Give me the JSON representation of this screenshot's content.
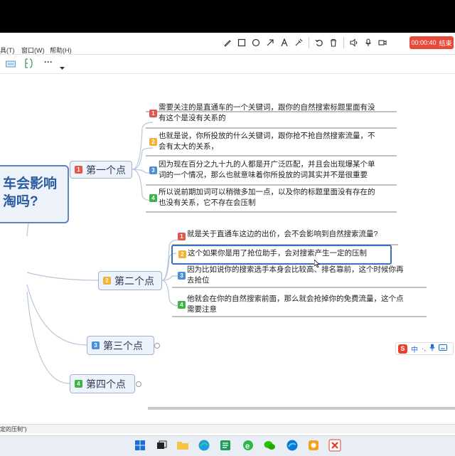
{
  "recorder": {
    "timer": "00:00:40",
    "end_label": "结束",
    "tools": [
      "pen-icon",
      "rectangle-icon",
      "circle-icon",
      "arrow-icon",
      "text-icon",
      "highlighter-icon",
      "undo-icon",
      "trash-icon",
      "speaker-icon",
      "microphone-icon",
      "camera-icon"
    ]
  },
  "menubar": {
    "items": [
      "具(T)",
      "窗口(W)",
      "帮助(H)"
    ]
  },
  "toolbar": {
    "more_label": "···"
  },
  "mindmap": {
    "central": [
      "车会影响",
      "淘吗?"
    ],
    "topics": [
      {
        "badge": "1",
        "label": "第一个点",
        "leaves": [
          {
            "badge": "1",
            "lines": [
              "需要关注的是直通车的一个关键词，跟你的自然搜索标题里面有没",
              "有这个是没有关系的"
            ]
          },
          {
            "badge": "2",
            "lines": [
              "也就是说，你所投放的什么关键词，跟你抢不抢自然搜索流量，不",
              "会有太大的关系，"
            ]
          },
          {
            "badge": "3",
            "lines": [
              "因为现在百分之九十九的人都是开广泛匹配，并且会出现爆某个单",
              "词的一个情况，那么也就意味着你所投放的词其实并不是很重要"
            ]
          },
          {
            "badge": "4",
            "lines": [
              "所以说前期加词可以稍微多加一点，以及你的标题里面没有存在的",
              "也没有关系，它不存在会压制"
            ]
          }
        ]
      },
      {
        "badge": "2",
        "label": "第二个点",
        "leaves": [
          {
            "badge": "1",
            "lines": [
              "就是关于直通车这边的出价，会不会影响到自然搜索流量?"
            ]
          },
          {
            "badge": "2",
            "lines": [
              "这个如果你是用了抢位助手，会对搜索产生一定的压制"
            ]
          },
          {
            "badge": "3",
            "lines": [
              "因为比如说你的搜索选手本身会比较高、排名靠前，这个时候你再",
              "去抢位"
            ]
          },
          {
            "badge": "4",
            "lines": [
              "他就会在你的自然搜索前面，那么就会抢掉你的免费流量，这个点",
              "需要注意"
            ]
          }
        ]
      },
      {
        "badge": "3",
        "label": "第三个点",
        "leaves": []
      },
      {
        "badge": "4",
        "label": "第四个点",
        "leaves": []
      }
    ]
  },
  "ime": {
    "brand": "S",
    "mode": "中"
  },
  "statusbar": {
    "text": "定的压制\")"
  },
  "taskbar": {
    "icons": [
      "windows-start-icon",
      "taskview-icon",
      "file-explorer-icon",
      "edge-browser-icon",
      "green-app-icon",
      "ie-browser-icon",
      "wechat-icon",
      "edge-alt-icon",
      "orange-app-icon",
      "xmind-icon"
    ]
  }
}
